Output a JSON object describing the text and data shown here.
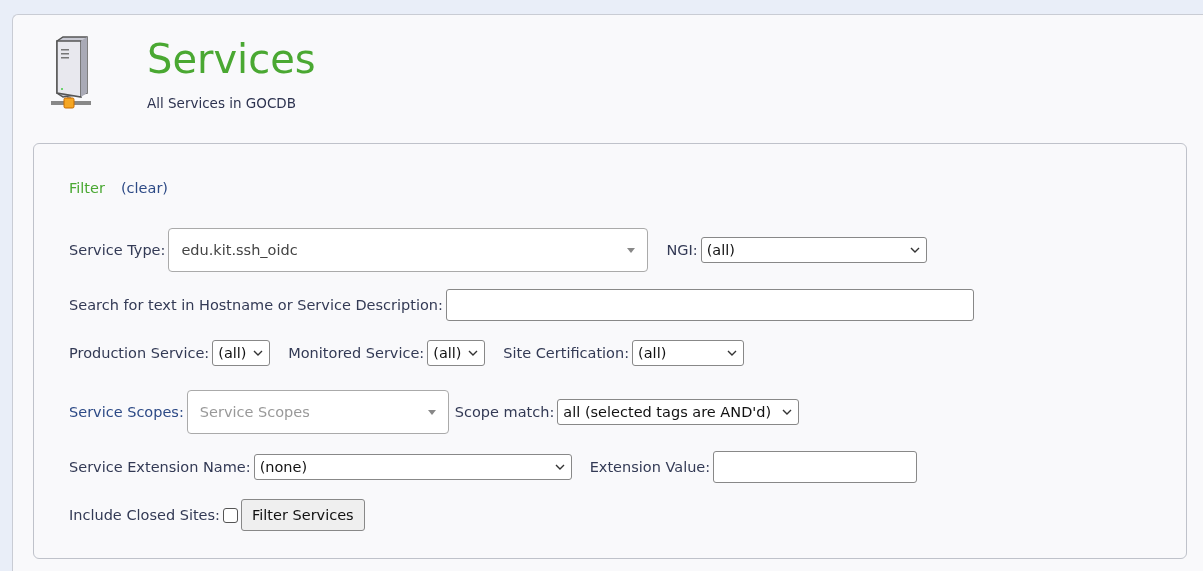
{
  "header": {
    "title": "Services",
    "subtitle": "All Services in GOCDB"
  },
  "filter": {
    "title": "Filter",
    "clear_link": "(clear)",
    "rows": [
      [
        {
          "kind": "combo",
          "label": "Service Type:",
          "value": "edu.kit.ssh_oidc"
        },
        {
          "kind": "select",
          "label": "NGI:",
          "value": "(all)"
        }
      ],
      [
        {
          "kind": "text",
          "label": "Search for text in Hostname or Service Description:"
        }
      ],
      [
        {
          "kind": "select",
          "label": "Production Service:",
          "value": "(all)"
        },
        {
          "kind": "select",
          "label": "Monitored Service:",
          "value": "(all)"
        },
        {
          "kind": "select",
          "label": "Site Certification:",
          "value": "(all)"
        }
      ],
      [
        {
          "kind": "combo",
          "label": "Service Scopes:",
          "label_link": true,
          "placeholder": "Service Scopes"
        },
        {
          "kind": "select",
          "label": "Scope match:",
          "value": "all (selected tags are AND'd)"
        }
      ],
      [
        {
          "kind": "select",
          "label": "Service Extension Name:",
          "value": "(none)"
        },
        {
          "kind": "text",
          "label": "Extension Value:"
        }
      ],
      [
        {
          "kind": "checkbox",
          "label": "Include Closed Sites:",
          "checked": false
        },
        {
          "kind": "button",
          "label": "Filter Services"
        }
      ]
    ]
  }
}
